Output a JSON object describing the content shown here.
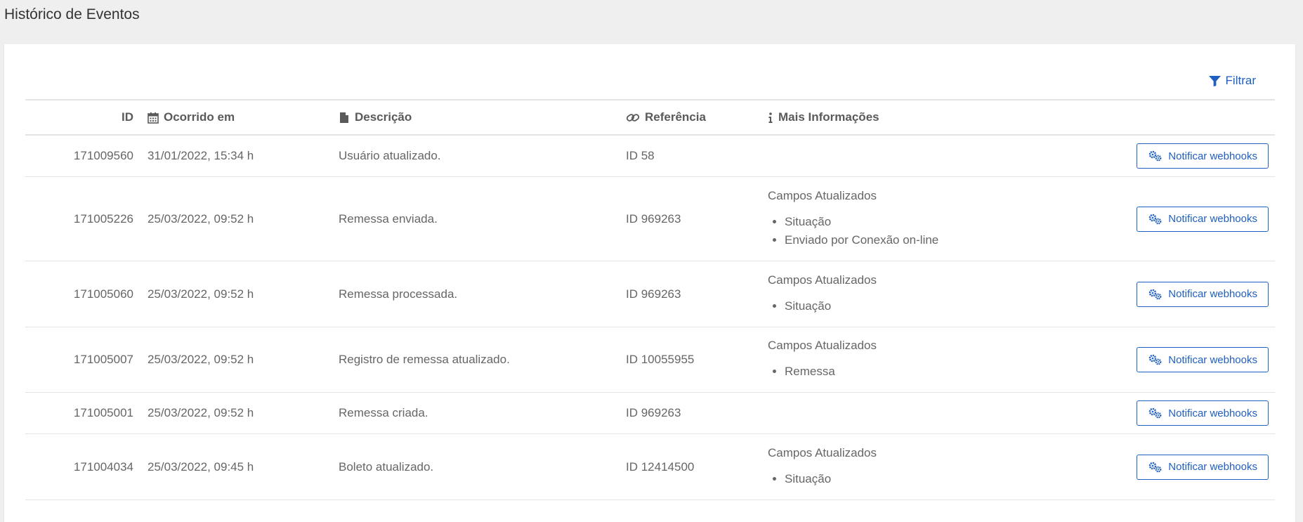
{
  "page": {
    "title": "Histórico de Eventos"
  },
  "toolbar": {
    "filter_label": "Filtrar"
  },
  "table": {
    "headers": {
      "id": "ID",
      "date": "Ocorrido em",
      "description": "Descrição",
      "reference": "Referência",
      "info": "Mais Informações"
    },
    "action_label": "Notificar webhooks",
    "rows": [
      {
        "id": "171009560",
        "date": "31/01/2022, 15:34 h",
        "description": "Usuário atualizado.",
        "reference": "ID 58",
        "info_title": "",
        "info_items": []
      },
      {
        "id": "171005226",
        "date": "25/03/2022, 09:52 h",
        "description": "Remessa enviada.",
        "reference": "ID 969263",
        "info_title": "Campos Atualizados",
        "info_items": [
          "Situação",
          "Enviado por Conexão on-line"
        ]
      },
      {
        "id": "171005060",
        "date": "25/03/2022, 09:52 h",
        "description": "Remessa processada.",
        "reference": "ID 969263",
        "info_title": "Campos Atualizados",
        "info_items": [
          "Situação"
        ]
      },
      {
        "id": "171005007",
        "date": "25/03/2022, 09:52 h",
        "description": "Registro de remessa atualizado.",
        "reference": "ID 10055955",
        "info_title": "Campos Atualizados",
        "info_items": [
          "Remessa"
        ]
      },
      {
        "id": "171005001",
        "date": "25/03/2022, 09:52 h",
        "description": "Remessa criada.",
        "reference": "ID 969263",
        "info_title": "",
        "info_items": []
      },
      {
        "id": "171004034",
        "date": "25/03/2022, 09:45 h",
        "description": "Boleto atualizado.",
        "reference": "ID 12414500",
        "info_title": "Campos Atualizados",
        "info_items": [
          "Situação"
        ]
      }
    ]
  },
  "icons": {
    "filter": "filter-icon",
    "calendar": "calendar-icon",
    "file": "file-icon",
    "link": "link-icon",
    "info": "info-icon",
    "gears": "gears-icon"
  },
  "colors": {
    "accent": "#1f5fbf",
    "background": "#efefef",
    "card": "#ffffff"
  }
}
